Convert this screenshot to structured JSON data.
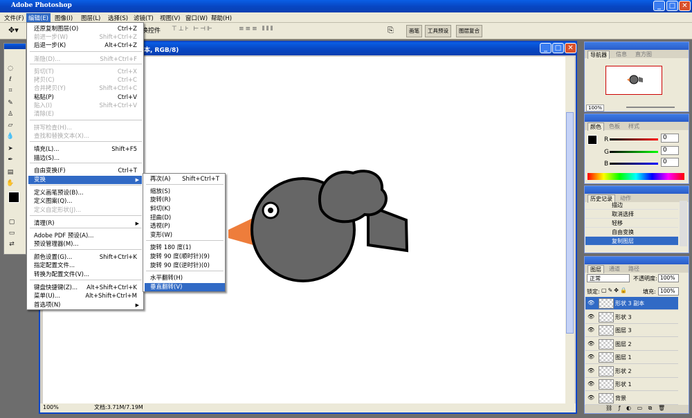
{
  "app_title": "Adobe Photoshop",
  "menubar": [
    "文件(F)",
    "编辑(E)",
    "图像(I)",
    "图层(L)",
    "选择(S)",
    "滤镜(T)",
    "视图(V)",
    "窗口(W)",
    "帮助(H)"
  ],
  "optbar": {
    "show_transform": "换控件",
    "palette_tabs": [
      "画笔",
      "工具预设",
      "图层复合"
    ]
  },
  "document": {
    "title": "本, RGB/8)",
    "zoom": "100%",
    "doc_info": "文档:3.71M/7.19M"
  },
  "edit_menu": [
    {
      "label": "还原复制图层(O)",
      "shortcut": "Ctrl+Z"
    },
    {
      "label": "前进一步(W)",
      "shortcut": "Shift+Ctrl+Z",
      "disabled": true
    },
    {
      "label": "后退一步(K)",
      "shortcut": "Alt+Ctrl+Z"
    },
    {
      "label": "渐隐(D)...",
      "shortcut": "Shift+Ctrl+F",
      "disabled": true
    },
    {
      "label": "剪切(T)",
      "shortcut": "Ctrl+X",
      "disabled": true
    },
    {
      "label": "拷贝(C)",
      "shortcut": "Ctrl+C",
      "disabled": true
    },
    {
      "label": "合并拷贝(Y)",
      "shortcut": "Shift+Ctrl+C",
      "disabled": true
    },
    {
      "label": "粘贴(P)",
      "shortcut": "Ctrl+V"
    },
    {
      "label": "贴入(I)",
      "shortcut": "Shift+Ctrl+V",
      "disabled": true
    },
    {
      "label": "清除(E)",
      "shortcut": "",
      "disabled": true
    },
    {
      "label": "拼写检查(H)...",
      "shortcut": "",
      "disabled": true
    },
    {
      "label": "查找和替换文本(X)...",
      "shortcut": "",
      "disabled": true
    },
    {
      "label": "填充(L)...",
      "shortcut": "Shift+F5"
    },
    {
      "label": "描边(S)...",
      "shortcut": ""
    },
    {
      "label": "自由变换(F)",
      "shortcut": "Ctrl+T"
    },
    {
      "label": "变换",
      "shortcut": "",
      "submenu": true,
      "highlighted": true
    },
    {
      "label": "定义画笔预设(B)...",
      "shortcut": ""
    },
    {
      "label": "定义图案(Q)...",
      "shortcut": ""
    },
    {
      "label": "定义自定形状(J)...",
      "shortcut": "",
      "disabled": true
    },
    {
      "label": "清理(R)",
      "shortcut": "",
      "submenu": true
    },
    {
      "label": "Adobe PDF 预设(A)...",
      "shortcut": ""
    },
    {
      "label": "预设管理器(M)...",
      "shortcut": ""
    },
    {
      "label": "颜色设置(G)...",
      "shortcut": "Shift+Ctrl+K"
    },
    {
      "label": "指定配置文件...",
      "shortcut": ""
    },
    {
      "label": "转换为配置文件(V)...",
      "shortcut": ""
    },
    {
      "label": "键盘快捷键(Z)...",
      "shortcut": "Alt+Shift+Ctrl+K"
    },
    {
      "label": "菜单(U)...",
      "shortcut": "Alt+Shift+Ctrl+M"
    },
    {
      "label": "首选项(N)",
      "shortcut": "",
      "submenu": true
    }
  ],
  "transform_menu": [
    {
      "label": "再次(A)",
      "shortcut": "Shift+Ctrl+T"
    },
    {
      "label": "缩放(S)",
      "shortcut": ""
    },
    {
      "label": "旋转(R)",
      "shortcut": ""
    },
    {
      "label": "斜切(K)",
      "shortcut": ""
    },
    {
      "label": "扭曲(D)",
      "shortcut": ""
    },
    {
      "label": "透视(P)",
      "shortcut": ""
    },
    {
      "label": "变形(W)",
      "shortcut": ""
    },
    {
      "label": "旋转 180 度(1)",
      "shortcut": ""
    },
    {
      "label": "旋转 90 度(顺时针)(9)",
      "shortcut": ""
    },
    {
      "label": "旋转 90 度(逆时针)(0)",
      "shortcut": ""
    },
    {
      "label": "水平翻转(H)",
      "shortcut": ""
    },
    {
      "label": "垂直翻转(V)",
      "shortcut": "",
      "highlighted": true
    }
  ],
  "navigator": {
    "tabs": [
      "导航器",
      "信息",
      "直方图"
    ],
    "zoom": "100%"
  },
  "color_panel": {
    "tabs": [
      "颜色",
      "色板",
      "样式"
    ],
    "channels": [
      {
        "name": "R",
        "value": "0"
      },
      {
        "name": "G",
        "value": "0"
      },
      {
        "name": "B",
        "value": "0"
      }
    ]
  },
  "history": {
    "tabs": [
      "历史记录",
      "动作"
    ],
    "items": [
      "描边",
      "取消选择",
      "轻移",
      "自由变换",
      "复制图层"
    ],
    "selected": 4
  },
  "layers": {
    "tabs": [
      "图层",
      "通道",
      "路径"
    ],
    "blend_mode": "正常",
    "opacity_label": "不透明度:",
    "opacity": "100%",
    "lock_label": "锁定:",
    "fill_label": "填充:",
    "fill": "100%",
    "items": [
      "形状 3 副本",
      "形状 3",
      "图层 3",
      "图层 2",
      "图层 1",
      "形状 2",
      "形状 1",
      "背景"
    ],
    "selected": 0
  },
  "colors": {
    "accent": "#316ac5",
    "bird_body": "#666666",
    "beak": "#ee7d3b",
    "outline": "#000000"
  }
}
